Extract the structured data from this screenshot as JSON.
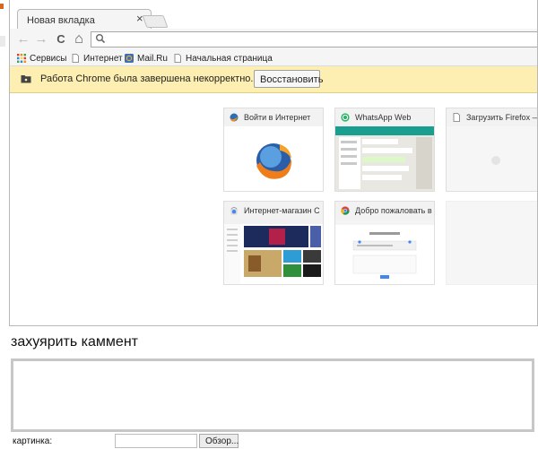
{
  "browser": {
    "tab": {
      "title": "Новая вкладка",
      "close_glyph": "×"
    },
    "toolbar": {
      "back_glyph": "←",
      "forward_glyph": "→",
      "reload_glyph": "C",
      "home_glyph": "⌂",
      "omnibox_value": ""
    },
    "bookmarks": [
      {
        "label": "Сервисы",
        "icon": "apps-grid-icon"
      },
      {
        "label": "Интернет",
        "icon": "page-icon"
      },
      {
        "label": "Mail.Ru",
        "icon": "mailru-icon"
      },
      {
        "label": "Начальная страница",
        "icon": "page-icon"
      }
    ],
    "infobar": {
      "message": "Работа Chrome была завершена некорректно.",
      "restore_label": "Восстановить"
    },
    "tiles": [
      {
        "title": "Войти в Интернет",
        "icon": "firefox-globe-icon"
      },
      {
        "title": "WhatsApp Web",
        "icon": "whatsapp-icon"
      },
      {
        "title": "Загрузить Firefox —",
        "icon": "page-icon"
      },
      {
        "title": "Интернет-магазин C",
        "icon": "chrome-webstore-icon"
      },
      {
        "title": "Добро пожаловать в",
        "icon": "chrome-icon"
      }
    ]
  },
  "comment_form": {
    "heading": "захуярить каммент",
    "textarea_value": "",
    "file_label": "картинка:",
    "browse_label": "Обзор..."
  },
  "colors": {
    "infobar_bg": "#fdefb2",
    "whatsapp_green": "#25b665",
    "toolbar_bg": "#f5f5f5"
  }
}
